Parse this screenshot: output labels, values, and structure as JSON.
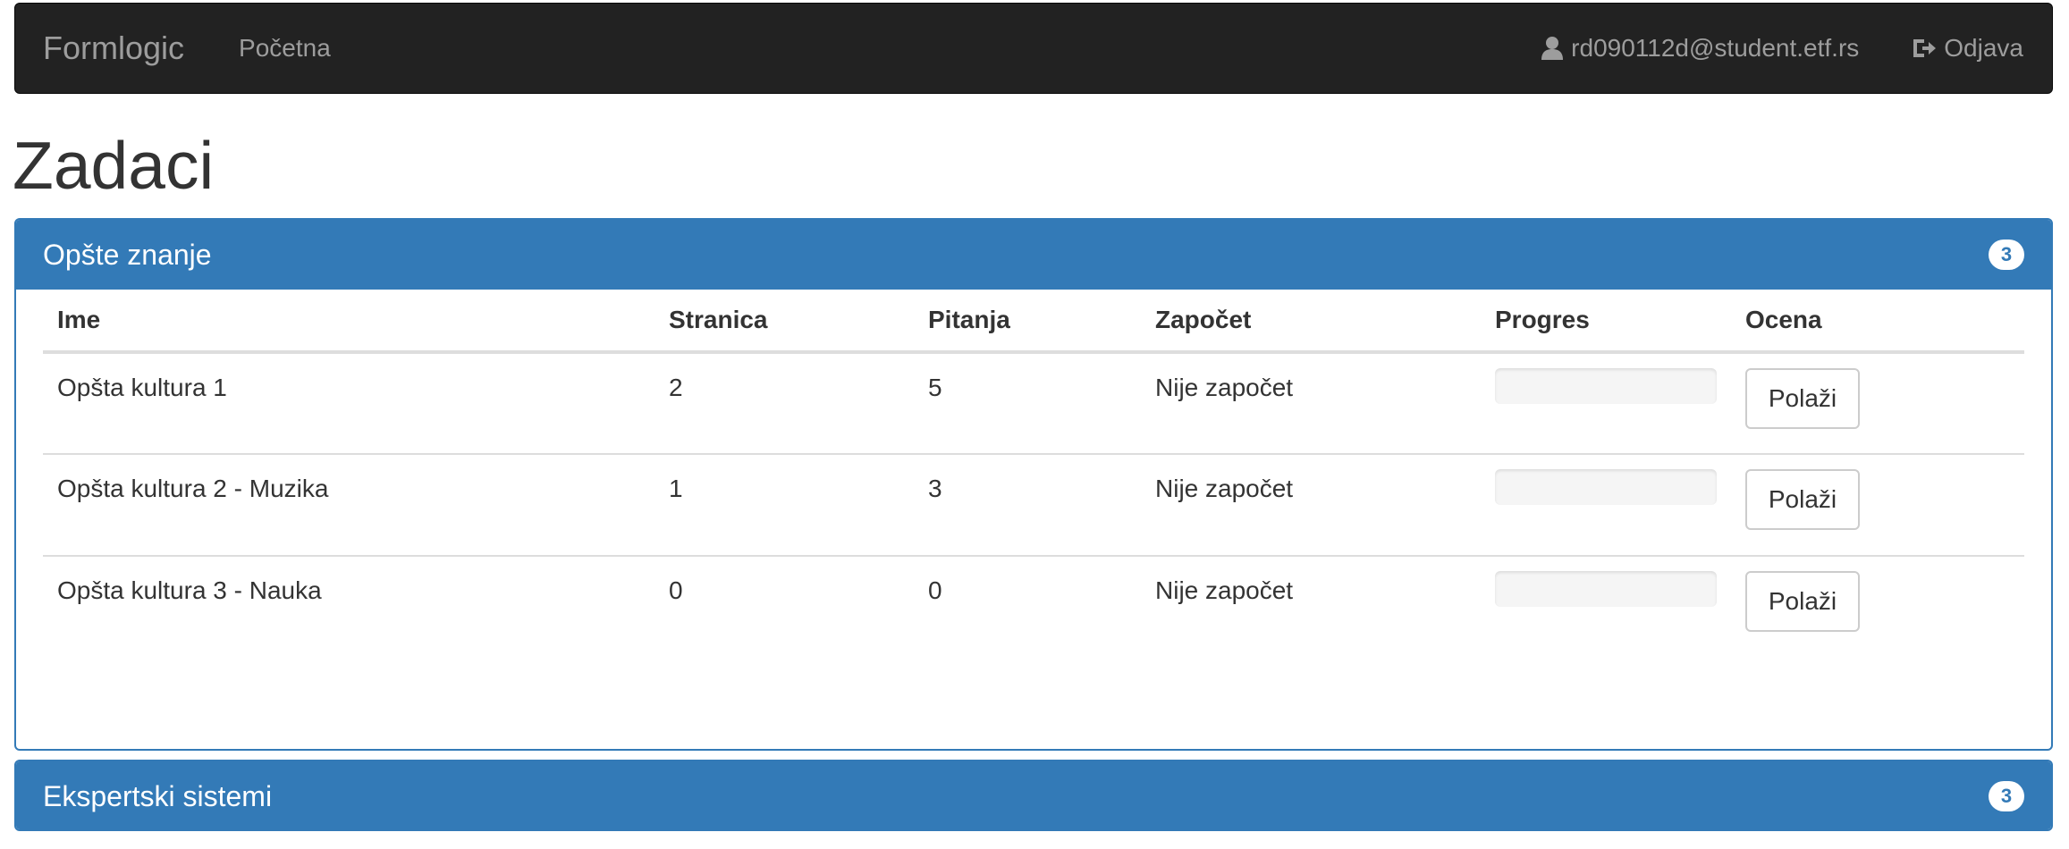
{
  "navbar": {
    "brand": "Formlogic",
    "home_link": "Početna",
    "user_email": "rd090112d@student.etf.rs",
    "logout_label": "Odjava",
    "icons": {
      "user": "user-icon",
      "logout": "logout-icon"
    }
  },
  "page": {
    "title": "Zadaci"
  },
  "panels": [
    {
      "title": "Opšte znanje",
      "badge": "3",
      "table": {
        "headers": [
          "Ime",
          "Stranica",
          "Pitanja",
          "Započet",
          "Progres",
          "Ocena"
        ],
        "rows": [
          {
            "name": "Opšta kultura 1",
            "pages": "2",
            "questions": "5",
            "started": "Nije započet",
            "progress": 0,
            "action": "Polaži"
          },
          {
            "name": "Opšta kultura 2 - Muzika",
            "pages": "1",
            "questions": "3",
            "started": "Nije započet",
            "progress": 0,
            "action": "Polaži"
          },
          {
            "name": "Opšta kultura 3 - Nauka",
            "pages": "0",
            "questions": "0",
            "started": "Nije započet",
            "progress": 0,
            "action": "Polaži"
          }
        ]
      }
    },
    {
      "title": "Ekspertski sistemi",
      "badge": "3"
    }
  ],
  "colors": {
    "primary": "#337ab7",
    "navbar": "#222222",
    "nav_text": "#9d9d9d"
  }
}
